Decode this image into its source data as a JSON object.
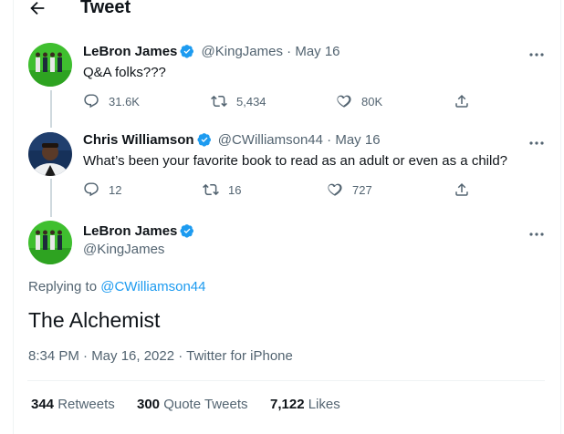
{
  "header": {
    "title": "Tweet"
  },
  "tweet1": {
    "name": "LeBron James",
    "handle": "@KingJames",
    "date": "May 16",
    "text": "Q&A folks???",
    "reply_count": "31.6K",
    "retweet_count": "5,434",
    "like_count": "80K"
  },
  "tweet2": {
    "name": "Chris Williamson",
    "handle": "@CWilliamson44",
    "date": "May 16",
    "text": "What’s been your favorite book to read as an adult or even as a child?",
    "reply_count": "12",
    "retweet_count": "16",
    "like_count": "727"
  },
  "main": {
    "name": "LeBron James",
    "handle": "@KingJames",
    "replying_prefix": "Replying to",
    "replying_to": "@CWilliamson44",
    "text": "The Alchemist",
    "time": "8:34 PM · May 16, 2022 · Twitter for iPhone",
    "stats": {
      "retweets_count": "344",
      "retweets_label": "Retweets",
      "quotes_count": "300",
      "quotes_label": "Quote Tweets",
      "likes_count": "7,122",
      "likes_label": "Likes"
    }
  },
  "colors": {
    "accent": "#1d9bf0",
    "muted": "#536471",
    "text": "#0f1419"
  }
}
